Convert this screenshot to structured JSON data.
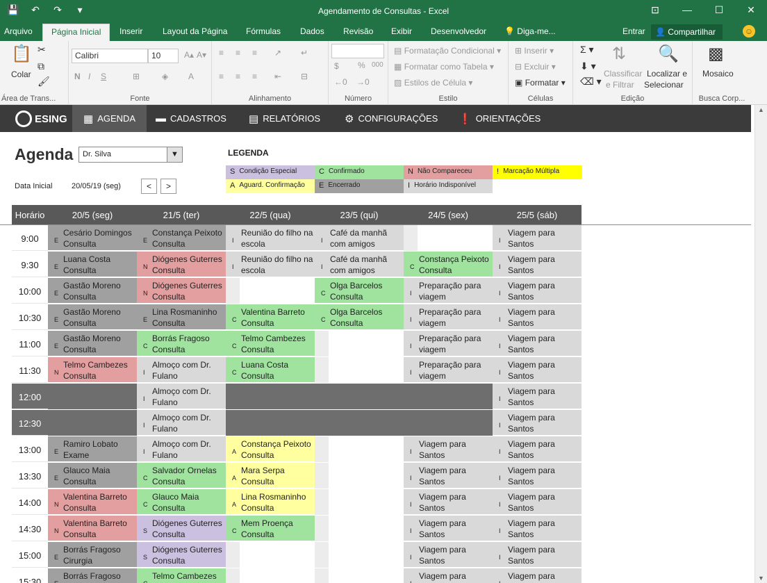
{
  "window": {
    "title": "Agendamento de Consultas - Excel",
    "min": "—",
    "restore": "☐",
    "close": "✕"
  },
  "ribbon_tabs": [
    "Arquivo",
    "Página Inicial",
    "Inserir",
    "Layout da Página",
    "Fórmulas",
    "Dados",
    "Revisão",
    "Exibir",
    "Desenvolvedor",
    "Diga-me..."
  ],
  "ribbon_right": {
    "enter": "Entrar",
    "share": "Compartilhar"
  },
  "ribbon": {
    "clipboard": {
      "paste": "Colar",
      "label": "Área de Trans..."
    },
    "font": {
      "name": "Calibri",
      "size": "10",
      "label": "Fonte"
    },
    "alignment": {
      "label": "Alinhamento"
    },
    "number": {
      "percent": "%",
      "thousands": "000",
      "label": "Número"
    },
    "styles": {
      "conditional": "Formatação Condicional",
      "as_table": "Formatar como Tabela",
      "cell_styles": "Estilos de Célula",
      "label": "Estilo"
    },
    "cells": {
      "insert": "Inserir",
      "delete": "Excluir",
      "format": "Formatar",
      "label": "Células"
    },
    "editing": {
      "sort_filter_1": "Classificar",
      "sort_filter_2": "e Filtrar",
      "find_1": "Localizar e",
      "find_2": "Selecionar",
      "label": "Edição"
    },
    "addin": {
      "mosaic": "Mosaico",
      "label": "Busca Corp..."
    }
  },
  "appbar": {
    "logo": "ESING",
    "menu": [
      {
        "label": "AGENDA",
        "icon": "calendar-icon"
      },
      {
        "label": "CADASTROS",
        "icon": "folder-icon"
      },
      {
        "label": "RELATÓRIOS",
        "icon": "report-icon"
      },
      {
        "label": "CONFIGURAÇÕES",
        "icon": "gears-icon"
      },
      {
        "label": "ORIENTAÇÕES",
        "icon": "exclamation-icon"
      }
    ]
  },
  "agenda": {
    "title": "Agenda",
    "doctor": "Dr. Silva",
    "start_label": "Data Inicial",
    "start_value": "20/05/19 (seg)",
    "prev": "<",
    "next": ">"
  },
  "legend": {
    "title": "LEGENDA",
    "items": [
      {
        "code": "S",
        "label": "Condição Especial",
        "color": "#cbc0e0"
      },
      {
        "code": "C",
        "label": "Confirmado",
        "color": "#9fe39f"
      },
      {
        "code": "N",
        "label": "Não Compareceu",
        "color": "#e39f9f"
      },
      {
        "code": "!",
        "label": "Marcação Múltipla",
        "color": "#ffff00"
      },
      {
        "code": "A",
        "label": "Aguard. Confirmação",
        "color": "#ffff9f"
      },
      {
        "code": "E",
        "label": "Encerrado",
        "color": "#a0a0a0"
      },
      {
        "code": "I",
        "label": "Horário Indisponível",
        "color": "#d9d9d9"
      }
    ]
  },
  "schedule": {
    "time_header": "Horário",
    "days": [
      "20/5 (seg)",
      "21/5 (ter)",
      "22/5 (qua)",
      "23/5 (qui)",
      "24/5 (sex)",
      "25/5 (sáb)"
    ],
    "rows": [
      {
        "time": "9:00",
        "cells": [
          {
            "c": "E",
            "t": "Cesário Domingos Consulta"
          },
          {
            "c": "E",
            "t": "Constança Peixoto Consulta"
          },
          {
            "c": "I",
            "t": "Reunião do filho na escola"
          },
          {
            "c": "I",
            "t": "Café da manhã com amigos"
          },
          {
            "c": "",
            "t": ""
          },
          {
            "c": "I",
            "t": "Viagem para Santos"
          }
        ]
      },
      {
        "time": "9:30",
        "cells": [
          {
            "c": "E",
            "t": "Luana Costa Consulta"
          },
          {
            "c": "N",
            "t": "Diógenes Guterres Consulta"
          },
          {
            "c": "I",
            "t": "Reunião do filho na escola"
          },
          {
            "c": "I",
            "t": "Café da manhã com amigos"
          },
          {
            "c": "C",
            "t": "Constança Peixoto Consulta"
          },
          {
            "c": "I",
            "t": "Viagem para Santos"
          }
        ]
      },
      {
        "time": "10:00",
        "cells": [
          {
            "c": "E",
            "t": "Gastão Moreno Consulta"
          },
          {
            "c": "N",
            "t": "Diógenes Guterres Consulta"
          },
          {
            "c": "",
            "t": ""
          },
          {
            "c": "C",
            "t": "Olga Barcelos Consulta"
          },
          {
            "c": "I",
            "t": "Preparação para viagem"
          },
          {
            "c": "I",
            "t": "Viagem para Santos"
          }
        ]
      },
      {
        "time": "10:30",
        "cells": [
          {
            "c": "E",
            "t": "Gastão Moreno Consulta"
          },
          {
            "c": "E",
            "t": "Lina Rosmaninho Consulta"
          },
          {
            "c": "C",
            "t": "Valentina Barreto Consulta"
          },
          {
            "c": "C",
            "t": "Olga Barcelos Consulta"
          },
          {
            "c": "I",
            "t": "Preparação para viagem"
          },
          {
            "c": "I",
            "t": "Viagem para Santos"
          }
        ]
      },
      {
        "time": "11:00",
        "cells": [
          {
            "c": "E",
            "t": "Gastão Moreno Consulta"
          },
          {
            "c": "C",
            "t": "Borrás Fragoso Consulta"
          },
          {
            "c": "C",
            "t": "Telmo Cambezes Consulta"
          },
          {
            "c": "",
            "t": ""
          },
          {
            "c": "I",
            "t": "Preparação para viagem"
          },
          {
            "c": "I",
            "t": "Viagem para Santos"
          }
        ]
      },
      {
        "time": "11:30",
        "cells": [
          {
            "c": "N",
            "t": "Telmo Cambezes Consulta"
          },
          {
            "c": "I",
            "t": "Almoço com Dr. Fulano"
          },
          {
            "c": "C",
            "t": "Luana Costa Consulta"
          },
          {
            "c": "",
            "t": ""
          },
          {
            "c": "I",
            "t": "Preparação para viagem"
          },
          {
            "c": "I",
            "t": "Viagem para Santos"
          }
        ]
      },
      {
        "time": "12:00",
        "block": true,
        "cells": [
          {
            "c": "X",
            "t": ""
          },
          {
            "c": "I",
            "t": "Almoço com Dr. Fulano"
          },
          {
            "c": "X",
            "t": ""
          },
          {
            "c": "X",
            "t": ""
          },
          {
            "c": "X",
            "t": ""
          },
          {
            "c": "I",
            "t": "Viagem para Santos"
          }
        ]
      },
      {
        "time": "12:30",
        "block": true,
        "cells": [
          {
            "c": "X",
            "t": ""
          },
          {
            "c": "I",
            "t": "Almoço com Dr. Fulano"
          },
          {
            "c": "X",
            "t": ""
          },
          {
            "c": "X",
            "t": ""
          },
          {
            "c": "X",
            "t": ""
          },
          {
            "c": "I",
            "t": "Viagem para Santos"
          }
        ]
      },
      {
        "time": "13:00",
        "cells": [
          {
            "c": "E",
            "t": "Ramiro Lobato Exame"
          },
          {
            "c": "I",
            "t": "Almoço com Dr. Fulano"
          },
          {
            "c": "A",
            "t": "Constança Peixoto Consulta"
          },
          {
            "c": "",
            "t": ""
          },
          {
            "c": "I",
            "t": "Viagem para Santos"
          },
          {
            "c": "I",
            "t": "Viagem para Santos"
          }
        ]
      },
      {
        "time": "13:30",
        "cells": [
          {
            "c": "E",
            "t": "Glauco Maia Consulta"
          },
          {
            "c": "C",
            "t": "Salvador Ornelas Consulta"
          },
          {
            "c": "A",
            "t": "Mara Serpa Consulta"
          },
          {
            "c": "",
            "t": ""
          },
          {
            "c": "I",
            "t": "Viagem para Santos"
          },
          {
            "c": "I",
            "t": "Viagem para Santos"
          }
        ]
      },
      {
        "time": "14:00",
        "cells": [
          {
            "c": "N",
            "t": "Valentina Barreto Consulta"
          },
          {
            "c": "C",
            "t": "Glauco Maia Consulta"
          },
          {
            "c": "A",
            "t": "Lina Rosmaninho Consulta"
          },
          {
            "c": "",
            "t": ""
          },
          {
            "c": "I",
            "t": "Viagem para Santos"
          },
          {
            "c": "I",
            "t": "Viagem para Santos"
          }
        ]
      },
      {
        "time": "14:30",
        "cells": [
          {
            "c": "N",
            "t": "Valentina Barreto Consulta"
          },
          {
            "c": "S",
            "t": "Diógenes Guterres Consulta"
          },
          {
            "c": "C",
            "t": "Mem Proença Consulta"
          },
          {
            "c": "",
            "t": ""
          },
          {
            "c": "I",
            "t": "Viagem para Santos"
          },
          {
            "c": "I",
            "t": "Viagem para Santos"
          }
        ]
      },
      {
        "time": "15:00",
        "cells": [
          {
            "c": "E",
            "t": "Borrás Fragoso Cirurgia"
          },
          {
            "c": "S",
            "t": "Diógenes Guterres Consulta"
          },
          {
            "c": "",
            "t": ""
          },
          {
            "c": "",
            "t": ""
          },
          {
            "c": "I",
            "t": "Viagem para Santos"
          },
          {
            "c": "I",
            "t": "Viagem para Santos"
          }
        ]
      },
      {
        "time": "15:30",
        "cells": [
          {
            "c": "E",
            "t": "Borrás Fragoso"
          },
          {
            "c": "C",
            "t": "Telmo Cambezes"
          },
          {
            "c": "",
            "t": ""
          },
          {
            "c": "",
            "t": ""
          },
          {
            "c": "I",
            "t": "Viagem para"
          },
          {
            "c": "I",
            "t": "Viagem para"
          }
        ]
      }
    ]
  },
  "colors": {
    "excel_green": "#217346",
    "app_bar": "#3b3b3b",
    "header_gray": "#595959",
    "block_gray": "#6e6e6e",
    "E": "#a0a0a0",
    "N": "#e39f9f",
    "C": "#9fe39f",
    "A": "#ffff9f",
    "S": "#cbc0e0",
    "I": "#d9d9d9",
    "empty": "#ffffff"
  }
}
